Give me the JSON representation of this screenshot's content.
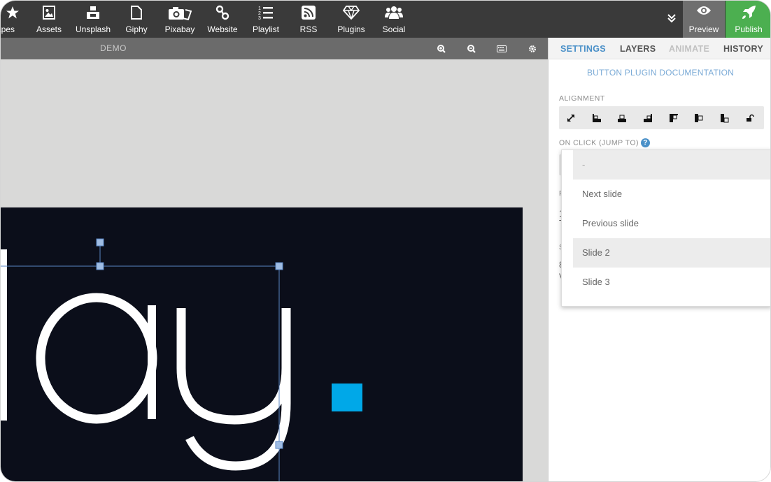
{
  "toolbar": {
    "items": [
      {
        "label": "apes",
        "icon": "star-icon"
      },
      {
        "label": "Assets",
        "icon": "image-icon"
      },
      {
        "label": "Unsplash",
        "icon": "unsplash-icon"
      },
      {
        "label": "Giphy",
        "icon": "file-icon"
      },
      {
        "label": "Pixabay",
        "icon": "camera-icon"
      },
      {
        "label": "Website",
        "icon": "link-icon"
      },
      {
        "label": "Playlist",
        "icon": "list-icon"
      },
      {
        "label": "RSS",
        "icon": "rss-icon"
      },
      {
        "label": "Plugins",
        "icon": "diamond-icon"
      },
      {
        "label": "Social",
        "icon": "users-icon"
      }
    ],
    "preview_label": "Preview",
    "publish_label": "Publish"
  },
  "canvas": {
    "title": "DEMO",
    "slide_text": "lay."
  },
  "panel": {
    "tabs": [
      "SETTINGS",
      "LAYERS",
      "ANIMATE",
      "HISTORY"
    ],
    "active_tab": "SETTINGS",
    "doc_link": "BUTTON PLUGIN DOCUMENTATION",
    "alignment_label": "ALIGNMENT",
    "on_click_label": "ON CLICK (JUMP TO)",
    "help_glyph": "?"
  },
  "dropdown": {
    "options": [
      "-",
      "Next slide",
      "Previous slide",
      "Slide 2",
      "Slide 3"
    ],
    "highlighted": [
      "-",
      "Slide 2"
    ]
  },
  "colors": {
    "toolbar_bg": "#3a3a3a",
    "publish_bg": "#4caf50",
    "accent_blue": "#4a90c8",
    "slide_bg": "#0b0e1a",
    "square_blue": "#00a8e8"
  }
}
